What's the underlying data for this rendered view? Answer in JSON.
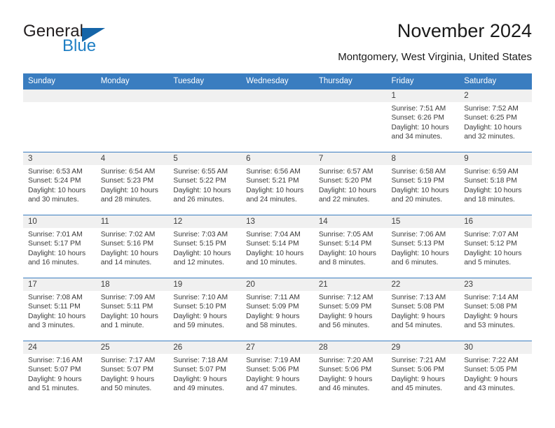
{
  "brand": {
    "name_part1": "General",
    "name_part2": "Blue",
    "flag_icon": "triangle-flag-icon"
  },
  "header": {
    "title": "November 2024",
    "location": "Montgomery, West Virginia, United States"
  },
  "colors": {
    "header_blue": "#3a7dc0",
    "brand_blue": "#1f7fc4",
    "daynum_band": "#f0f0f0",
    "text": "#3b3b3b"
  },
  "weekdays": [
    "Sunday",
    "Monday",
    "Tuesday",
    "Wednesday",
    "Thursday",
    "Friday",
    "Saturday"
  ],
  "labels": {
    "sunrise": "Sunrise:",
    "sunset": "Sunset:",
    "daylight": "Daylight:"
  },
  "weeks": [
    [
      {
        "day": "",
        "empty": true
      },
      {
        "day": "",
        "empty": true
      },
      {
        "day": "",
        "empty": true
      },
      {
        "day": "",
        "empty": true
      },
      {
        "day": "",
        "empty": true
      },
      {
        "day": "1",
        "sunrise": "Sunrise: 7:51 AM",
        "sunset": "Sunset: 6:26 PM",
        "daylight_l1": "Daylight: 10 hours",
        "daylight_l2": "and 34 minutes."
      },
      {
        "day": "2",
        "sunrise": "Sunrise: 7:52 AM",
        "sunset": "Sunset: 6:25 PM",
        "daylight_l1": "Daylight: 10 hours",
        "daylight_l2": "and 32 minutes."
      }
    ],
    [
      {
        "day": "3",
        "sunrise": "Sunrise: 6:53 AM",
        "sunset": "Sunset: 5:24 PM",
        "daylight_l1": "Daylight: 10 hours",
        "daylight_l2": "and 30 minutes."
      },
      {
        "day": "4",
        "sunrise": "Sunrise: 6:54 AM",
        "sunset": "Sunset: 5:23 PM",
        "daylight_l1": "Daylight: 10 hours",
        "daylight_l2": "and 28 minutes."
      },
      {
        "day": "5",
        "sunrise": "Sunrise: 6:55 AM",
        "sunset": "Sunset: 5:22 PM",
        "daylight_l1": "Daylight: 10 hours",
        "daylight_l2": "and 26 minutes."
      },
      {
        "day": "6",
        "sunrise": "Sunrise: 6:56 AM",
        "sunset": "Sunset: 5:21 PM",
        "daylight_l1": "Daylight: 10 hours",
        "daylight_l2": "and 24 minutes."
      },
      {
        "day": "7",
        "sunrise": "Sunrise: 6:57 AM",
        "sunset": "Sunset: 5:20 PM",
        "daylight_l1": "Daylight: 10 hours",
        "daylight_l2": "and 22 minutes."
      },
      {
        "day": "8",
        "sunrise": "Sunrise: 6:58 AM",
        "sunset": "Sunset: 5:19 PM",
        "daylight_l1": "Daylight: 10 hours",
        "daylight_l2": "and 20 minutes."
      },
      {
        "day": "9",
        "sunrise": "Sunrise: 6:59 AM",
        "sunset": "Sunset: 5:18 PM",
        "daylight_l1": "Daylight: 10 hours",
        "daylight_l2": "and 18 minutes."
      }
    ],
    [
      {
        "day": "10",
        "sunrise": "Sunrise: 7:01 AM",
        "sunset": "Sunset: 5:17 PM",
        "daylight_l1": "Daylight: 10 hours",
        "daylight_l2": "and 16 minutes."
      },
      {
        "day": "11",
        "sunrise": "Sunrise: 7:02 AM",
        "sunset": "Sunset: 5:16 PM",
        "daylight_l1": "Daylight: 10 hours",
        "daylight_l2": "and 14 minutes."
      },
      {
        "day": "12",
        "sunrise": "Sunrise: 7:03 AM",
        "sunset": "Sunset: 5:15 PM",
        "daylight_l1": "Daylight: 10 hours",
        "daylight_l2": "and 12 minutes."
      },
      {
        "day": "13",
        "sunrise": "Sunrise: 7:04 AM",
        "sunset": "Sunset: 5:14 PM",
        "daylight_l1": "Daylight: 10 hours",
        "daylight_l2": "and 10 minutes."
      },
      {
        "day": "14",
        "sunrise": "Sunrise: 7:05 AM",
        "sunset": "Sunset: 5:14 PM",
        "daylight_l1": "Daylight: 10 hours",
        "daylight_l2": "and 8 minutes."
      },
      {
        "day": "15",
        "sunrise": "Sunrise: 7:06 AM",
        "sunset": "Sunset: 5:13 PM",
        "daylight_l1": "Daylight: 10 hours",
        "daylight_l2": "and 6 minutes."
      },
      {
        "day": "16",
        "sunrise": "Sunrise: 7:07 AM",
        "sunset": "Sunset: 5:12 PM",
        "daylight_l1": "Daylight: 10 hours",
        "daylight_l2": "and 5 minutes."
      }
    ],
    [
      {
        "day": "17",
        "sunrise": "Sunrise: 7:08 AM",
        "sunset": "Sunset: 5:11 PM",
        "daylight_l1": "Daylight: 10 hours",
        "daylight_l2": "and 3 minutes."
      },
      {
        "day": "18",
        "sunrise": "Sunrise: 7:09 AM",
        "sunset": "Sunset: 5:11 PM",
        "daylight_l1": "Daylight: 10 hours",
        "daylight_l2": "and 1 minute."
      },
      {
        "day": "19",
        "sunrise": "Sunrise: 7:10 AM",
        "sunset": "Sunset: 5:10 PM",
        "daylight_l1": "Daylight: 9 hours",
        "daylight_l2": "and 59 minutes."
      },
      {
        "day": "20",
        "sunrise": "Sunrise: 7:11 AM",
        "sunset": "Sunset: 5:09 PM",
        "daylight_l1": "Daylight: 9 hours",
        "daylight_l2": "and 58 minutes."
      },
      {
        "day": "21",
        "sunrise": "Sunrise: 7:12 AM",
        "sunset": "Sunset: 5:09 PM",
        "daylight_l1": "Daylight: 9 hours",
        "daylight_l2": "and 56 minutes."
      },
      {
        "day": "22",
        "sunrise": "Sunrise: 7:13 AM",
        "sunset": "Sunset: 5:08 PM",
        "daylight_l1": "Daylight: 9 hours",
        "daylight_l2": "and 54 minutes."
      },
      {
        "day": "23",
        "sunrise": "Sunrise: 7:14 AM",
        "sunset": "Sunset: 5:08 PM",
        "daylight_l1": "Daylight: 9 hours",
        "daylight_l2": "and 53 minutes."
      }
    ],
    [
      {
        "day": "24",
        "sunrise": "Sunrise: 7:16 AM",
        "sunset": "Sunset: 5:07 PM",
        "daylight_l1": "Daylight: 9 hours",
        "daylight_l2": "and 51 minutes."
      },
      {
        "day": "25",
        "sunrise": "Sunrise: 7:17 AM",
        "sunset": "Sunset: 5:07 PM",
        "daylight_l1": "Daylight: 9 hours",
        "daylight_l2": "and 50 minutes."
      },
      {
        "day": "26",
        "sunrise": "Sunrise: 7:18 AM",
        "sunset": "Sunset: 5:07 PM",
        "daylight_l1": "Daylight: 9 hours",
        "daylight_l2": "and 49 minutes."
      },
      {
        "day": "27",
        "sunrise": "Sunrise: 7:19 AM",
        "sunset": "Sunset: 5:06 PM",
        "daylight_l1": "Daylight: 9 hours",
        "daylight_l2": "and 47 minutes."
      },
      {
        "day": "28",
        "sunrise": "Sunrise: 7:20 AM",
        "sunset": "Sunset: 5:06 PM",
        "daylight_l1": "Daylight: 9 hours",
        "daylight_l2": "and 46 minutes."
      },
      {
        "day": "29",
        "sunrise": "Sunrise: 7:21 AM",
        "sunset": "Sunset: 5:06 PM",
        "daylight_l1": "Daylight: 9 hours",
        "daylight_l2": "and 45 minutes."
      },
      {
        "day": "30",
        "sunrise": "Sunrise: 7:22 AM",
        "sunset": "Sunset: 5:05 PM",
        "daylight_l1": "Daylight: 9 hours",
        "daylight_l2": "and 43 minutes."
      }
    ]
  ]
}
